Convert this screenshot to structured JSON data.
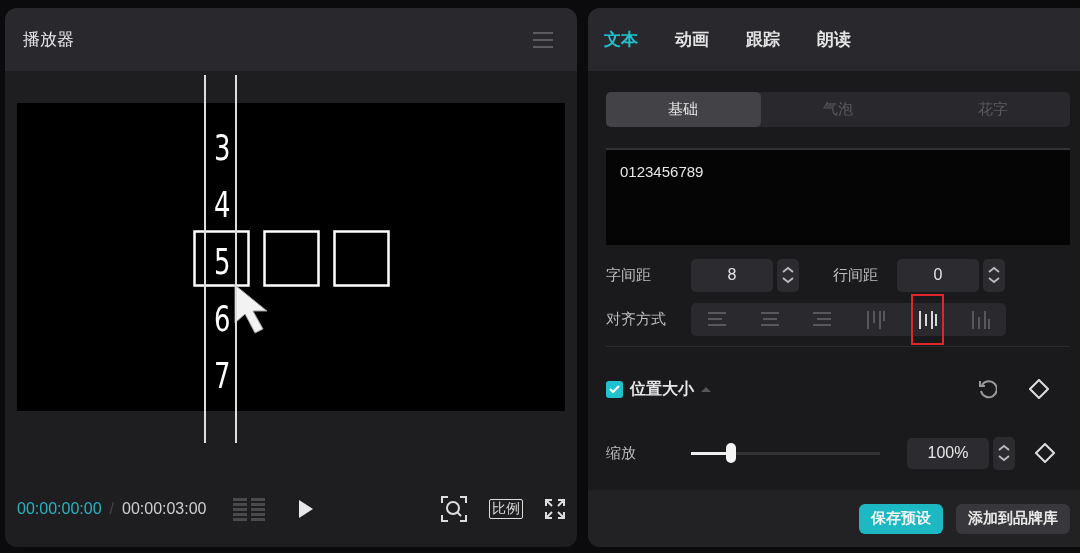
{
  "player": {
    "title": "播放器",
    "preview": {
      "glyphs": [
        "3",
        "4",
        "5",
        "6",
        "7"
      ]
    },
    "current_time": "00:00:00:00",
    "time_separator": "/",
    "total_time": "00:00:03:00",
    "ratio_button": "比例"
  },
  "inspector": {
    "tabs": [
      {
        "label": "文本",
        "selected": true
      },
      {
        "label": "动画",
        "selected": false
      },
      {
        "label": "跟踪",
        "selected": false
      },
      {
        "label": "朗读",
        "selected": false
      }
    ],
    "subtabs": [
      {
        "label": "基础",
        "selected": true
      },
      {
        "label": "气泡",
        "selected": false
      },
      {
        "label": "花字",
        "selected": false
      }
    ],
    "text_value": "0123456789",
    "letter_spacing": {
      "label": "字间距",
      "value": "8"
    },
    "line_spacing": {
      "label": "行间距",
      "value": "0"
    },
    "alignment": {
      "label": "对齐方式",
      "options": [
        {
          "kind": "left",
          "selected": false
        },
        {
          "kind": "center",
          "selected": false
        },
        {
          "kind": "right",
          "selected": false
        },
        {
          "kind": "top",
          "selected": false
        },
        {
          "kind": "middle",
          "selected": true
        },
        {
          "kind": "bottom",
          "selected": false
        }
      ]
    },
    "position_size": {
      "label": "位置大小",
      "checked": true
    },
    "scale": {
      "label": "缩放",
      "level": 0.21,
      "value": "100%"
    },
    "buttons": [
      {
        "label": "保存预设",
        "kind": "primary"
      },
      {
        "label": "添加到品牌库",
        "kind": "secondary"
      }
    ]
  }
}
